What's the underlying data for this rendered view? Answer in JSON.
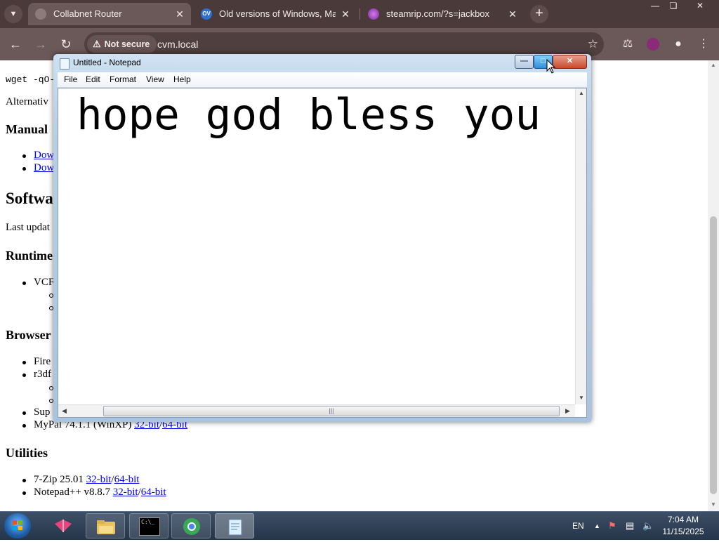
{
  "browser": {
    "tabs": [
      {
        "title": "Collabnet Router",
        "active": true
      },
      {
        "title": "Old versions of Windows, Mac",
        "active": false,
        "favicon_text": "OV"
      },
      {
        "title": "steamrip.com/?s=jackbox",
        "active": false
      }
    ],
    "security_label": "Not secure",
    "url": "cvm.local"
  },
  "page": {
    "cmd_prefix": "wget -qO-",
    "alt_text": "Alternativ",
    "manual_heading": "Manual",
    "download_links": [
      "Dow",
      "Dow"
    ],
    "software_heading": "Softwa",
    "last_updated": "Last updat",
    "runtime_heading": "Runtime",
    "runtime_item": "VCF",
    "browsers_heading": "Browser",
    "browser_items": [
      "Fire",
      "r3df",
      "Sup"
    ],
    "mypal": {
      "name": "MyPal 74.1.1 (WinXP) ",
      "link32": "32-bit",
      "sep": "/",
      "link64": "64-bit"
    },
    "utilities_heading": "Utilities",
    "utilities": [
      {
        "name": "7-Zip 25.01 ",
        "link32": "32-bit",
        "sep": "/",
        "link64": "64-bit"
      },
      {
        "name": "Notepad++ v8.8.7 ",
        "link32": "32-bit",
        "sep": "/",
        "link64": "64-bit"
      }
    ]
  },
  "notepad": {
    "title": "Untitled - Notepad",
    "menu": [
      "File",
      "Edit",
      "Format",
      "View",
      "Help"
    ],
    "content": "hope god bless you",
    "scroll_grip": "|||"
  },
  "taskbar": {
    "language": "EN",
    "time": "7:04 AM",
    "date": "11/15/2025",
    "cmd_label": "C:\\_"
  },
  "colors": {
    "chrome_frame": "#4a3a3a",
    "chrome_toolbar": "#6b5858",
    "link": "#0000ee"
  }
}
